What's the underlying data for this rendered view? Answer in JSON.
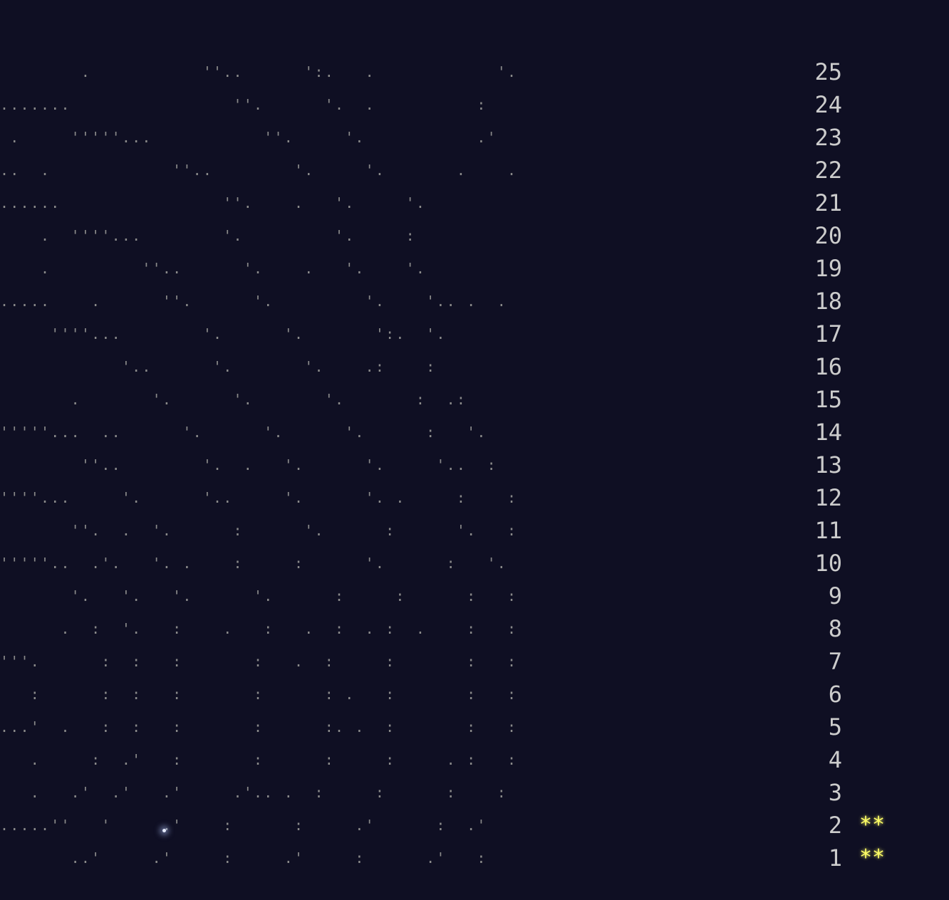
{
  "calendar": {
    "rows": [
      {
        "day": "25",
        "art": "        .           ''..      ':.   .            '.",
        "stars": ""
      },
      {
        "day": "24",
        "art": ".......                ''.      '.  .          :",
        "stars": ""
      },
      {
        "day": "23",
        "art": " .     '''''...           ''.     '.           .'",
        "stars": ""
      },
      {
        "day": "22",
        "art": "..  .            ''..        '.     '.       .    .",
        "stars": ""
      },
      {
        "day": "21",
        "art": "......                ''.    .   '.     '.",
        "stars": ""
      },
      {
        "day": "20",
        "art": "    .  ''''...        '.         '.     :",
        "stars": ""
      },
      {
        "day": "19",
        "art": "    .         ''..      '.    .   '.    '.",
        "stars": ""
      },
      {
        "day": "18",
        "art": ".....    .      ''.      '.         '.    '.. .  .",
        "stars": ""
      },
      {
        "day": "17",
        "art": "     ''''...        '.      '.       ':.  '.",
        "stars": ""
      },
      {
        "day": "16",
        "art": "            '..      '.       '.    .:    :",
        "stars": ""
      },
      {
        "day": "15",
        "art": "       .       '.      '.       '.       :  .:",
        "stars": ""
      },
      {
        "day": "14",
        "art": "'''''...  ..      '.      '.      '.      :   '.",
        "stars": ""
      },
      {
        "day": "13",
        "art": "        ''..        '.  .   '.      '.     '..  :",
        "stars": ""
      },
      {
        "day": "12",
        "art": "''''...     '.      '..     '.      '. .     :    :",
        "stars": ""
      },
      {
        "day": "11",
        "art": "       ''.  .  '.      :      '.      :      '.   :",
        "stars": ""
      },
      {
        "day": "10",
        "art": "'''''..  .'.   '. .    :     :      '.      :   '.",
        "stars": ""
      },
      {
        "day": "9",
        "art": "       '.   '.   '.      '.      :     :      :   :",
        "stars": ""
      },
      {
        "day": "8",
        "art": "      .  :  '.   :    .   :   .  :  . :  .    :   :",
        "stars": ""
      },
      {
        "day": "7",
        "art": "'''.      :  :   :       :   .  :     :       :   :",
        "stars": ""
      },
      {
        "day": "6",
        "art": "   :      :  :   :       :      : .   :       :   :",
        "stars": ""
      },
      {
        "day": "5",
        "art": "...'  .   :  :   :       :      :. .  :       :   :",
        "stars": ""
      },
      {
        "day": "4",
        "art": "   .     :  .'   :       :      :     :     . :   :",
        "stars": ""
      },
      {
        "day": "3",
        "art": "   .   .'  .'   .'     .'.. .  :     :      :    :",
        "stars": ""
      },
      {
        "day": "2",
        "art": ".....''   '     .'    :      :     .'      :  .'",
        "stars": "**"
      },
      {
        "day": "1",
        "art": "       ..'     .'     :     .'     :      .'   :",
        "stars": "**"
      }
    ]
  }
}
